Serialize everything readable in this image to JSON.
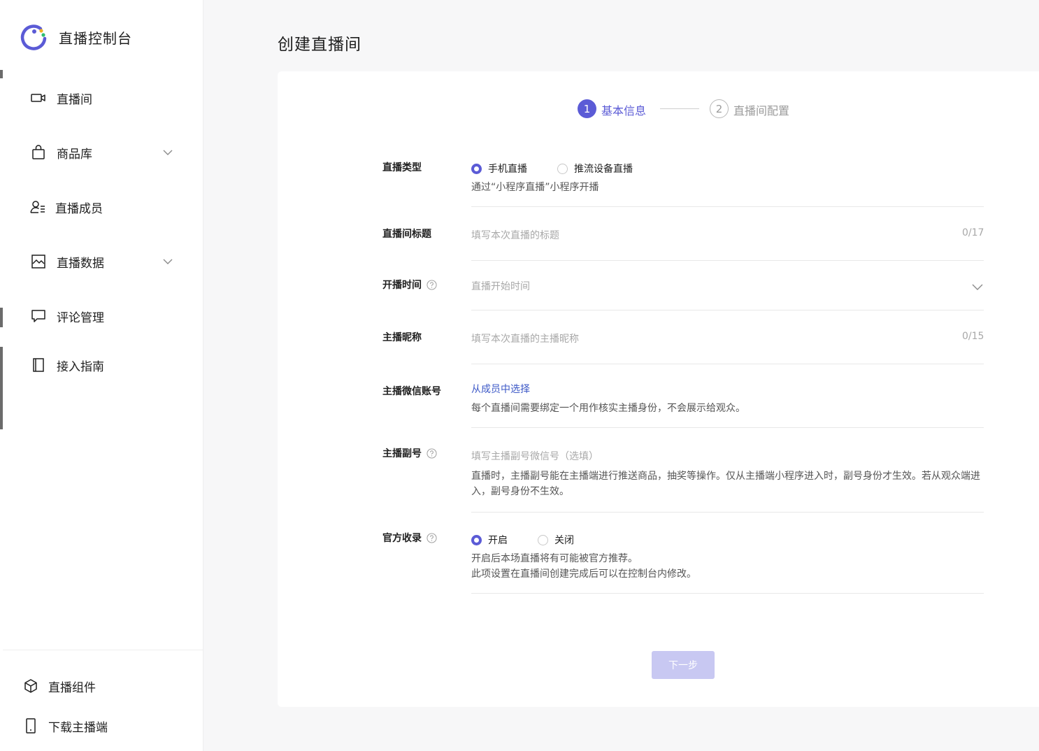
{
  "app": {
    "title": "直播控制台"
  },
  "sidebar": {
    "items": [
      {
        "label": "直播间",
        "icon": "video-camera-icon"
      },
      {
        "label": "商品库",
        "icon": "shopping-bag-icon"
      },
      {
        "label": "直播成员",
        "icon": "user-list-icon"
      },
      {
        "label": "直播数据",
        "icon": "chart-image-icon"
      },
      {
        "label": "评论管理",
        "icon": "comment-icon"
      },
      {
        "label": "接入指南",
        "icon": "book-icon"
      }
    ],
    "bottom": [
      {
        "label": "直播组件",
        "icon": "cube-icon"
      },
      {
        "label": "下载主播端",
        "icon": "mobile-phone-icon"
      }
    ]
  },
  "page": {
    "title": "创建直播间"
  },
  "steps": [
    {
      "number": "1",
      "label": "基本信息",
      "active": true
    },
    {
      "number": "2",
      "label": "直播间配置",
      "active": false
    }
  ],
  "form": {
    "live_type": {
      "label": "直播类型",
      "options": [
        "手机直播",
        "推流设备直播"
      ],
      "selected": "手机直播",
      "hint": "通过“小程序直播”小程序开播"
    },
    "room_title": {
      "label": "直播间标题",
      "placeholder": "填写本次直播的标题",
      "counter": "0/17"
    },
    "start_time": {
      "label": "开播时间",
      "placeholder": "直播开始时间"
    },
    "anchor_nickname": {
      "label": "主播昵称",
      "placeholder": "填写本次直播的主播昵称",
      "counter": "0/15"
    },
    "anchor_wechat": {
      "label": "主播微信账号",
      "link": "从成员中选择",
      "hint": "每个直播间需要绑定一个用作核实主播身份，不会展示给观众。"
    },
    "assistant": {
      "label": "主播副号",
      "placeholder": "填写主播副号微信号（选填）",
      "hint": "直播时，主播副号能在主播端进行推送商品，抽奖等操作。仅从主播端小程序进入时，副号身份才生效。若从观众端进入，副号身份不生效。"
    },
    "official": {
      "label": "官方收录",
      "options": [
        "开启",
        "关闭"
      ],
      "selected": "开启",
      "hint_1": "开启后本场直播将有可能被官方推荐。",
      "hint_2": "此项设置在直播间创建完成后可以在控制台内修改。"
    }
  },
  "actions": {
    "next_label": "下一步"
  },
  "colors": {
    "accent": "#5b5bd6",
    "link": "#3d59c7",
    "disabled_button": "#c8c8f2"
  }
}
